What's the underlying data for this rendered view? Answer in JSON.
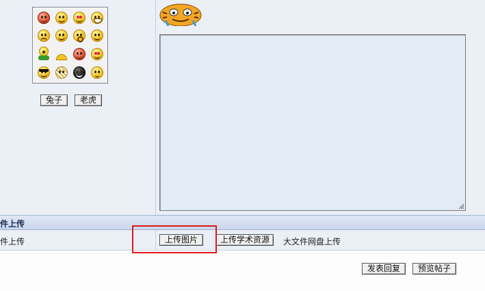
{
  "emoji_panel": {
    "rows": [
      [
        "red",
        "smile",
        "love",
        "grin"
      ],
      [
        "sad",
        "smile",
        "surprised",
        "grin"
      ],
      [
        "frog",
        "hidden",
        "red",
        "love"
      ],
      [
        "cool",
        "grid",
        "dark",
        "thinking"
      ]
    ],
    "buttons": [
      "兔子",
      "老虎"
    ]
  },
  "upload": {
    "section_title": "件上传",
    "row_label": "件上传",
    "upload_image_button": "上传图片",
    "upload_academic_button": "上传学术资源",
    "large_file_text": "大文件网盘上传"
  },
  "footer": {
    "submit_button": "发表回复",
    "preview_button": "预览帖子"
  }
}
